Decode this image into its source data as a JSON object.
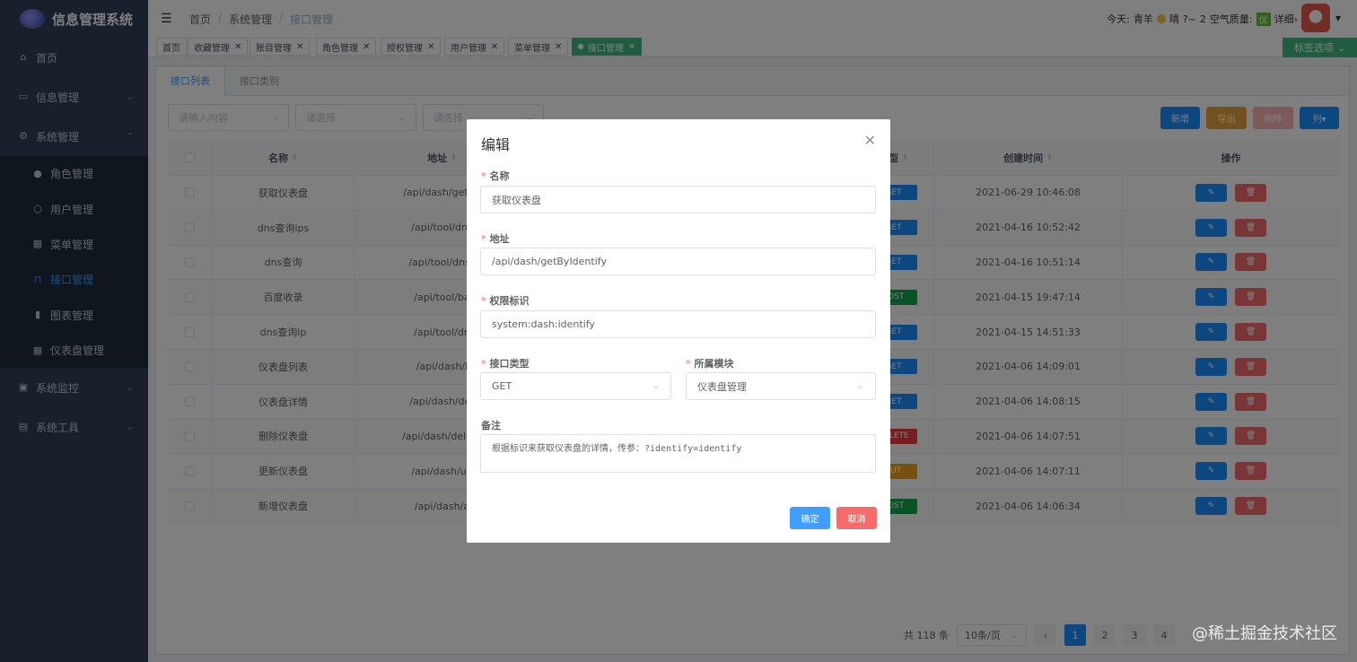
{
  "app": {
    "title": "信息管理系统"
  },
  "sidebar": {
    "items": [
      {
        "icon": "home-icon",
        "label": "首页"
      },
      {
        "icon": "info-box-icon",
        "label": "信息管理"
      },
      {
        "icon": "gear-icon",
        "label": "系统管理"
      }
    ],
    "sub_items": [
      {
        "icon": "user-group-icon",
        "label": "角色管理"
      },
      {
        "icon": "user-icon",
        "label": "用户管理"
      },
      {
        "icon": "grid-icon",
        "label": "菜单管理"
      },
      {
        "icon": "lock-icon",
        "label": "接口管理"
      },
      {
        "icon": "bar-chart-icon",
        "label": "图表管理"
      },
      {
        "icon": "dashboard-grid-icon",
        "label": "仪表盘管理"
      }
    ],
    "bottom_items": [
      {
        "icon": "monitor-icon",
        "label": "系统监控"
      },
      {
        "icon": "toolbox-icon",
        "label": "系统工具"
      }
    ]
  },
  "header": {
    "breadcrumb": [
      "首页",
      "系统管理",
      "接口管理"
    ],
    "weather": {
      "today_label": "今天:",
      "city": "青羊",
      "condition": "晴",
      "temp": "?~",
      "temp2": "2",
      "air_label": "空气质量:",
      "air_value": "优",
      "detail": "详细›"
    }
  },
  "tags": {
    "items": [
      "首页",
      "收藏管理",
      "账目管理",
      "角色管理",
      "授权管理",
      "用户管理",
      "菜单管理",
      "接口管理"
    ],
    "options_label": "标签选项"
  },
  "main": {
    "tabs": [
      "接口列表",
      "接口类别"
    ],
    "filters": {
      "search_placeholder": "请输入内容",
      "select1_placeholder": "请选择",
      "select2_placeholder": "请选择"
    },
    "actions": {
      "add": "新增",
      "export": "导出",
      "delete": "删除",
      "columns": "列▾"
    },
    "table": {
      "headers": {
        "name": "名称",
        "path": "地址",
        "type": "类型",
        "created": "创建时间",
        "ops": "操作"
      },
      "rows": [
        {
          "name": "获取仪表盘",
          "path": "/api/dash/getBy",
          "method": "GET",
          "created": "2021-06-29 10:46:08"
        },
        {
          "name": "dns查询ips",
          "path": "/api/tool/dns",
          "method": "GET",
          "created": "2021-04-16 10:52:42"
        },
        {
          "name": "dns查询",
          "path": "/api/tool/dnss",
          "method": "GET",
          "created": "2021-04-16 10:51:14"
        },
        {
          "name": "百度收录",
          "path": "/api/tool/ba",
          "method": "POST",
          "created": "2021-04-15 19:47:14"
        },
        {
          "name": "dns查询ip",
          "path": "/api/tool/dn",
          "method": "GET",
          "created": "2021-04-15 14:51:33"
        },
        {
          "name": "仪表盘列表",
          "path": "/api/dash/l",
          "method": "GET",
          "created": "2021-04-06 14:09:01"
        },
        {
          "name": "仪表盘详情",
          "path": "/api/dash/det",
          "method": "GET",
          "created": "2021-04-06 14:08:15"
        },
        {
          "name": "删除仪表盘",
          "path": "/api/dash/delete",
          "method": "DELETE",
          "created": "2021-04-06 14:07:51"
        },
        {
          "name": "更新仪表盘",
          "path": "/api/dash/up",
          "method": "PUT",
          "created": "2021-04-06 14:07:11"
        },
        {
          "name": "新增仪表盘",
          "path": "/api/dash/a",
          "method": "POST",
          "created": "2021-04-06 14:06:34"
        }
      ]
    },
    "pagination": {
      "total": "共 118 条",
      "page_size": "10条/页",
      "pages": [
        "1",
        "2",
        "3",
        "4"
      ],
      "prev": "‹"
    }
  },
  "dialog": {
    "title": "编辑",
    "fields": {
      "name_label": "名称",
      "name_value": "获取仪表盘",
      "path_label": "地址",
      "path_value": "/api/dash/getByIdentify",
      "perm_label": "权限标识",
      "perm_value": "system:dash:identify",
      "type_label": "接口类型",
      "type_value": "GET",
      "module_label": "所属模块",
      "module_value": "仪表盘管理",
      "remark_label": "备注",
      "remark_value": "根据标识来获取仪表盘的详情，传参：?identify=identify"
    },
    "ok": "确定",
    "cancel": "取消"
  },
  "watermark": "@稀土掘金技术社区"
}
